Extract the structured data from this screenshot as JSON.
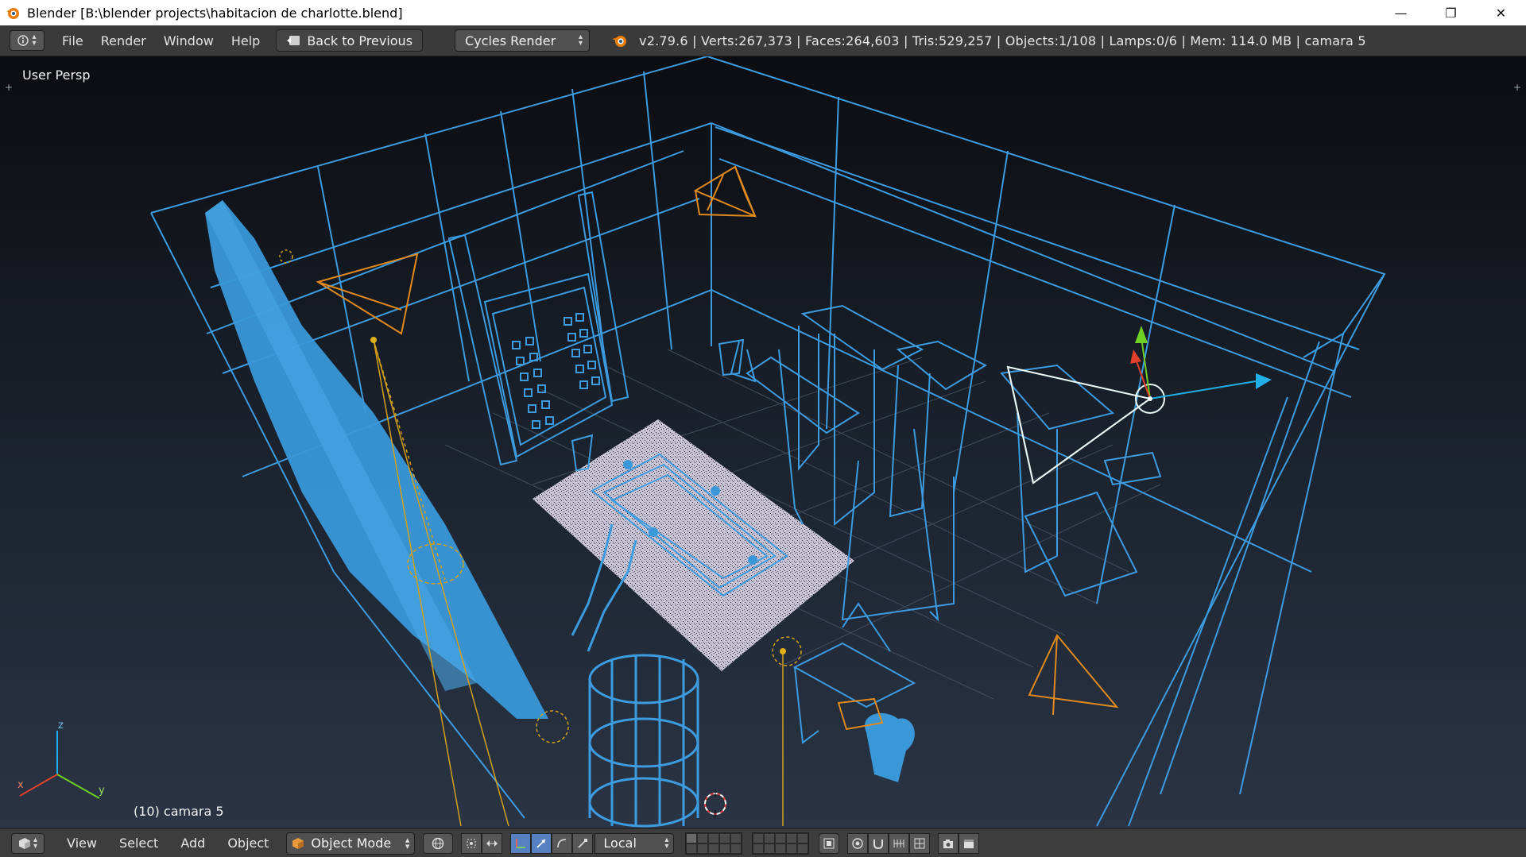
{
  "window": {
    "title": "Blender [B:\\blender projects\\habitacion de charlotte.blend]",
    "minimize_glyph": "—",
    "maximize_glyph": "❐",
    "close_glyph": "✕"
  },
  "info_header": {
    "menus": [
      "File",
      "Render",
      "Window",
      "Help"
    ],
    "back_button": "Back to Previous",
    "render_engine": "Cycles Render",
    "stats": "v2.79.6 | Verts:267,373 | Faces:264,603 | Tris:529,257 | Objects:1/108 | Lamps:0/6 | Mem: 114.0 MB | camara 5"
  },
  "viewport": {
    "view_label": "User Persp",
    "active_object_label": "(10) camara 5",
    "axis_labels": {
      "z": "z",
      "x": "x",
      "y": "y"
    },
    "colors": {
      "wire": "#3d9be0",
      "selected_fill": "#3a98d8",
      "camera": "#e08a1e",
      "lamp_line": "#d4a018",
      "rug": "#c8c4d6",
      "active_camera": "#e8f6f4",
      "gizmo_x": "#e0402a",
      "gizmo_y": "#6ed022",
      "gizmo_z": "#22b0e8"
    }
  },
  "view_header": {
    "menus": [
      "View",
      "Select",
      "Add",
      "Object"
    ],
    "mode": "Object Mode",
    "orientation": "Local"
  }
}
